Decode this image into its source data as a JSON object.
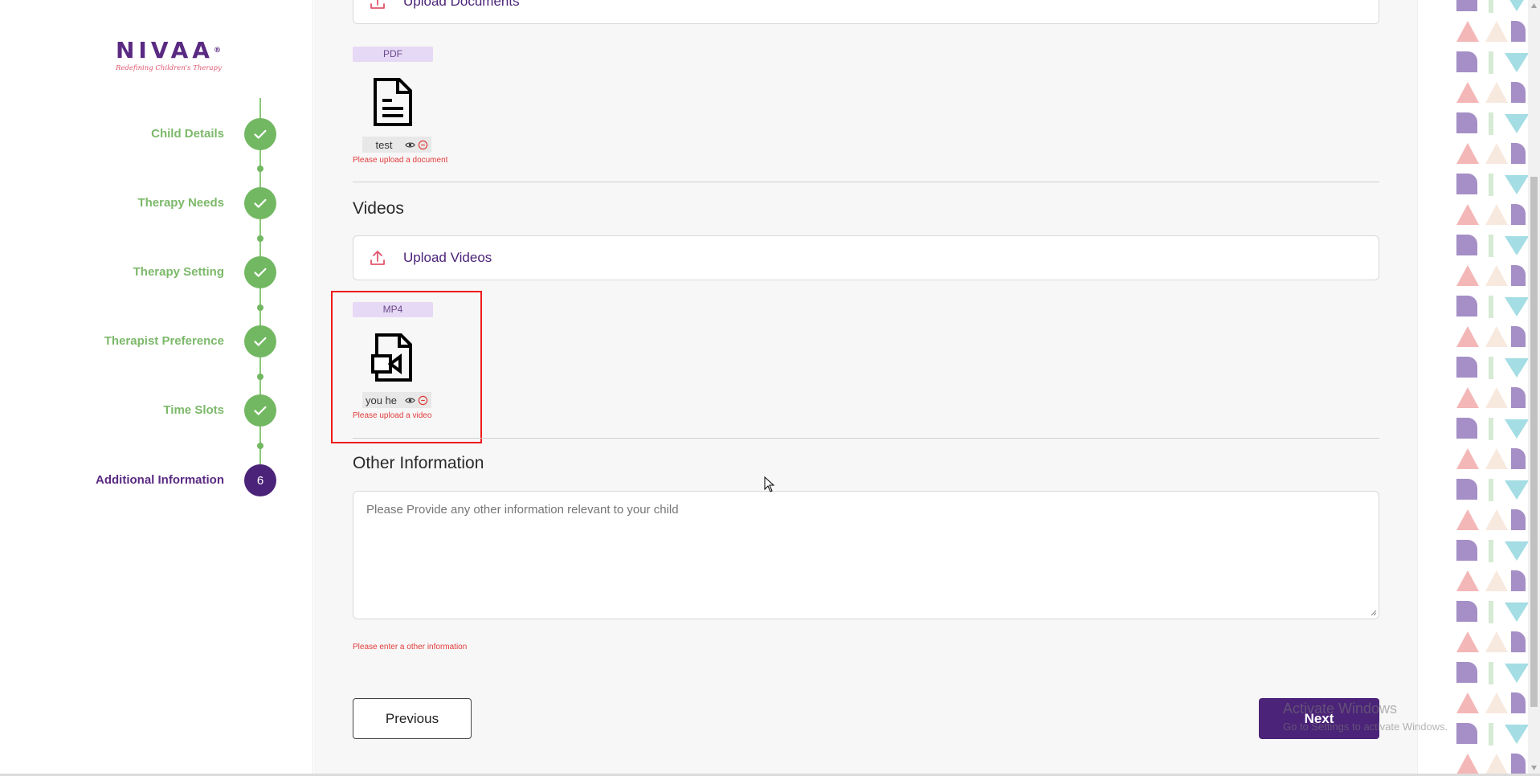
{
  "logo": {
    "brand": "NIVAA",
    "trademark": "®",
    "tagline": "Redefining Children's Therapy"
  },
  "steps": [
    {
      "label": "Child Details",
      "status": "complete"
    },
    {
      "label": "Therapy Needs",
      "status": "complete"
    },
    {
      "label": "Therapy Setting",
      "status": "complete"
    },
    {
      "label": "Therapist Preference",
      "status": "complete"
    },
    {
      "label": "Time Slots",
      "status": "complete"
    },
    {
      "label": "Additional Information",
      "status": "active",
      "number": "6"
    }
  ],
  "documents": {
    "upload_label": "Upload Documents",
    "file": {
      "type_badge": "PDF",
      "name": "test",
      "error": "Please upload a document"
    }
  },
  "videos": {
    "title": "Videos",
    "upload_label": "Upload Videos",
    "file": {
      "type_badge": "MP4",
      "name": "you he",
      "error": "Please upload a video"
    }
  },
  "other": {
    "title": "Other Information",
    "placeholder": "Please Provide any other information relevant to your child",
    "error": "Please enter a other information"
  },
  "buttons": {
    "previous": "Previous",
    "next": "Next"
  },
  "watermark": {
    "line1": "Activate Windows",
    "line2": "Go to Settings to activate Windows."
  },
  "colors": {
    "primary": "#4b2378",
    "success": "#72b862",
    "error": "#e23b3b",
    "accent": "#e0566c"
  }
}
